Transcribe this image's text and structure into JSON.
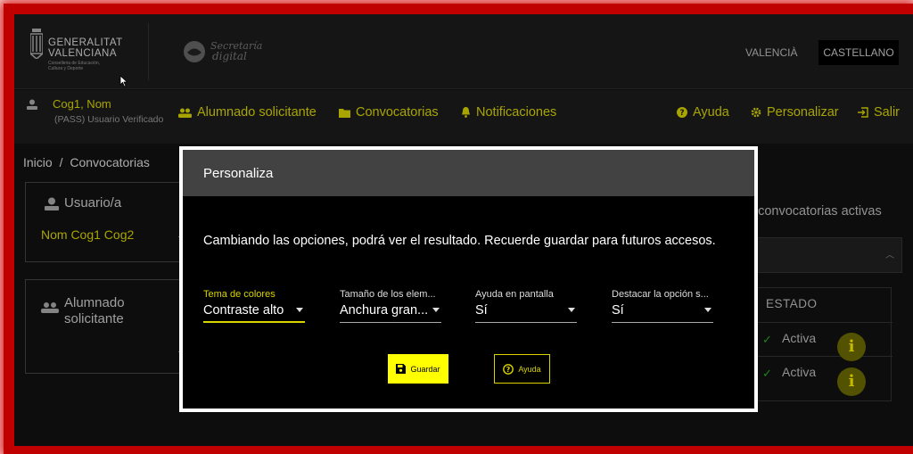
{
  "colors": {
    "accent": "#d9d400",
    "save_bg": "#ffff00",
    "frame_glow": "#c00000",
    "modal_border": "#ffffff",
    "modal_header": "#424242"
  },
  "header": {
    "brand": {
      "line1": "GENERALITAT",
      "line2": "VALENCIANA",
      "line3": "Conselleria de Educación, Cultura y Deporte"
    },
    "secretaria": {
      "line1": "Secretaría",
      "line2": "digital"
    },
    "languages": [
      "VALENCIÀ",
      "CASTELLANO"
    ]
  },
  "nav": {
    "user": {
      "name": "Cog1, Nom",
      "subtitle": "(PASS) Usuario Verificado",
      "icon": "user-icon"
    },
    "items": [
      {
        "label": "Alumnado solicitante",
        "icon": "people-icon"
      },
      {
        "label": "Convocatorias",
        "icon": "folder-icon"
      },
      {
        "label": "Notificaciones",
        "icon": "bell-icon"
      }
    ],
    "right_items": [
      {
        "label": "Ayuda",
        "icon": "help-icon"
      },
      {
        "label": "Personalizar",
        "icon": "gear-icon"
      },
      {
        "label": "Salir",
        "icon": "logout-icon"
      }
    ]
  },
  "breadcrumb": {
    "home": "Inicio",
    "separator": "/",
    "current": "Convocatorias"
  },
  "cards": [
    {
      "title": "Usuario/a",
      "link": "Nom Cog1 Cog2",
      "arrow": "→"
    },
    {
      "title_line1": "Alumnado",
      "title_line2": "solicitante",
      "arrow": "→"
    }
  ],
  "right_panel": {
    "text": "o convocatorias activas",
    "table_header": "ESTADO",
    "rows": [
      {
        "status": "Activa"
      },
      {
        "status": "Activa"
      }
    ],
    "info_label": "i"
  },
  "modal": {
    "title": "Personaliza",
    "description": "Cambiando las opciones, podrá ver el resultado. Recuerde guardar para futuros accesos.",
    "fields": [
      {
        "label": "Tema de colores",
        "value": "Contraste alto"
      },
      {
        "label": "Tamaño de los elem...",
        "value": "Anchura gran..."
      },
      {
        "label": "Ayuda en pantalla",
        "value": "Sí"
      },
      {
        "label": "Destacar la opción s...",
        "value": "Sí"
      }
    ],
    "save_label": "Guardar",
    "help_label": "Ayuda"
  }
}
